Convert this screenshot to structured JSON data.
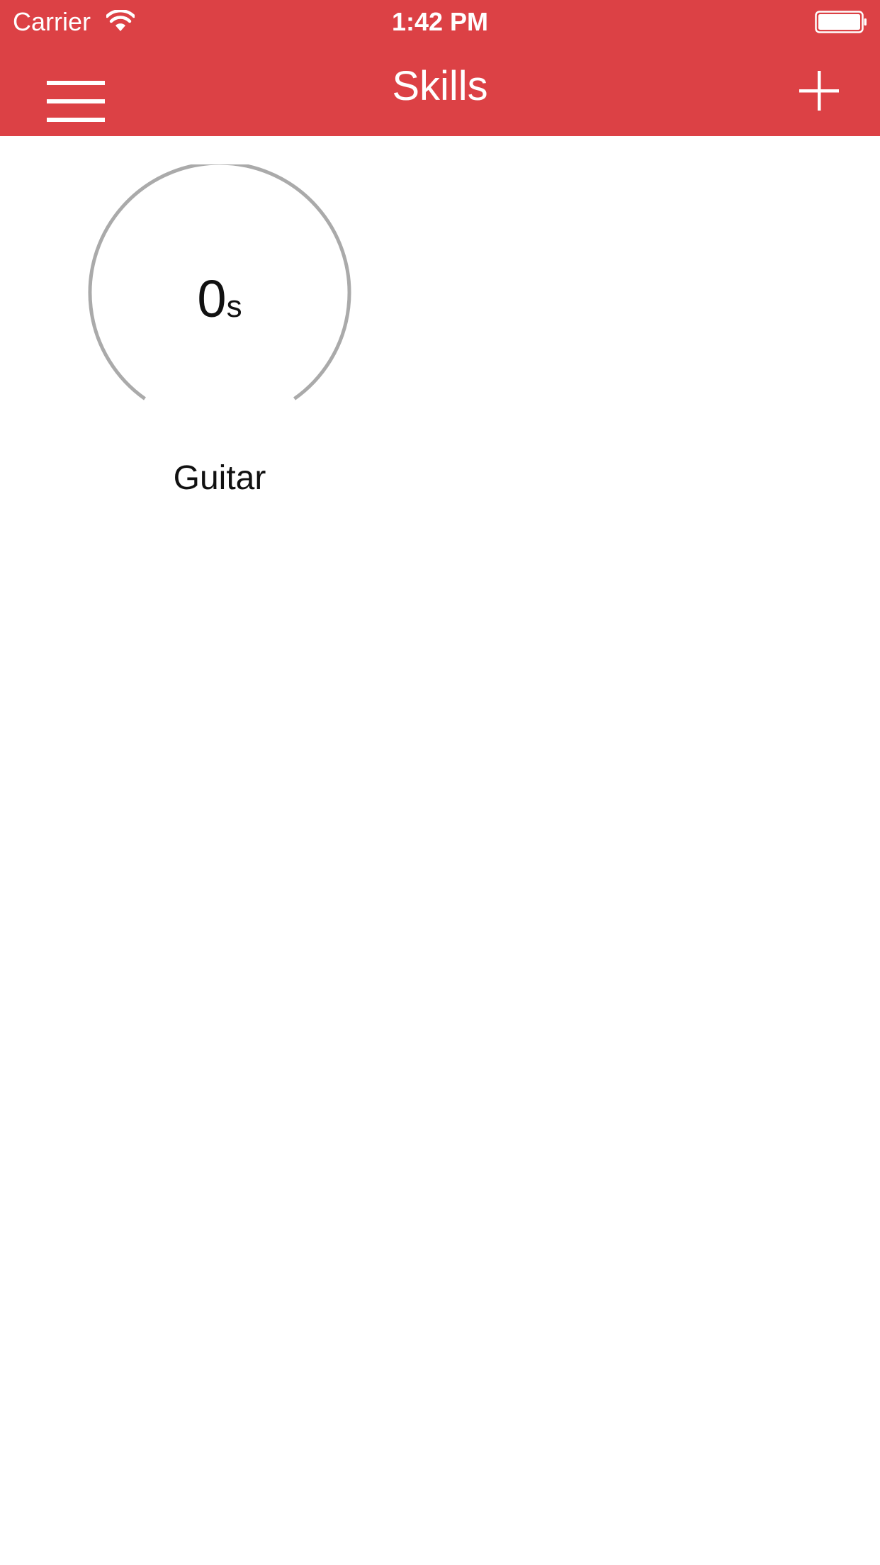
{
  "status_bar": {
    "carrier": "Carrier",
    "time": "1:42 PM",
    "wifi_icon": "wifi-icon",
    "battery_icon": "battery-icon"
  },
  "nav_bar": {
    "title": "Skills",
    "menu_icon": "hamburger-menu-icon",
    "add_icon": "plus-icon",
    "background_color": "#dc4145"
  },
  "skills": [
    {
      "name": "Guitar",
      "time_value": "0",
      "time_unit": "s",
      "gauge_color": "#aaaaaa"
    }
  ]
}
